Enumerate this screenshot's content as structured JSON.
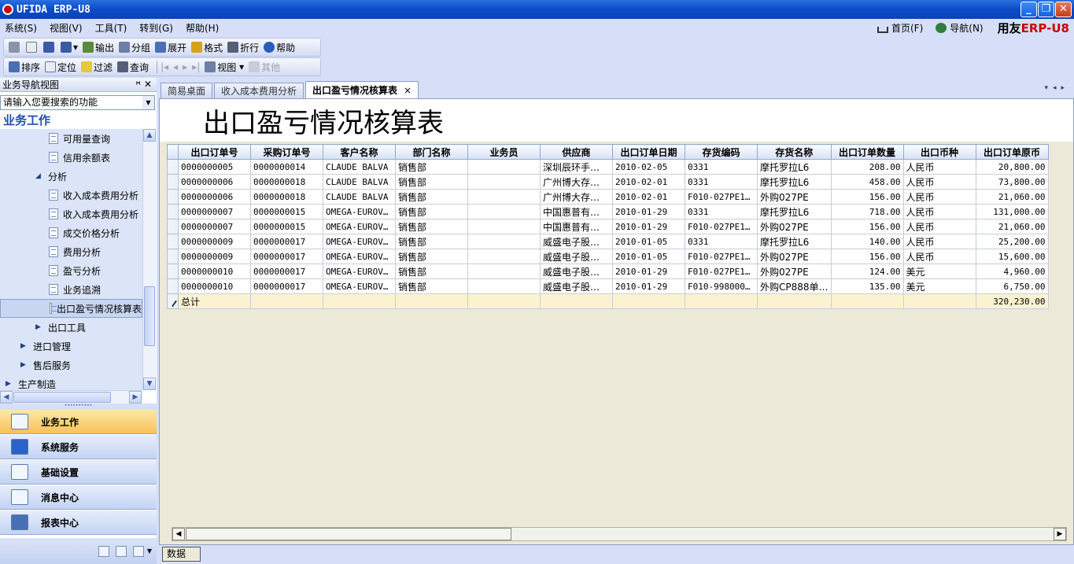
{
  "window": {
    "title": "UFIDA ERP-U8"
  },
  "menu": [
    "系统(S)",
    "视图(V)",
    "工具(T)",
    "转到(G)",
    "帮助(H)"
  ],
  "menu_right": {
    "home": "首页(F)",
    "nav": "导航(N)",
    "brand_a": "用友",
    "brand_b": "ERP-U8"
  },
  "toolbar1": [
    "输出",
    "分组",
    "展开",
    "格式",
    "折行",
    "帮助"
  ],
  "toolbar2": [
    "排序",
    "定位",
    "过滤",
    "查询",
    "视图",
    "其他"
  ],
  "left": {
    "header": "业务导航视图",
    "search_placeholder": "请输入您要搜索的功能",
    "section": "业务工作",
    "tree": [
      {
        "label": "可用量查询",
        "type": "doc",
        "indent": 3
      },
      {
        "label": "信用余额表",
        "type": "doc",
        "indent": 3
      },
      {
        "label": "分析",
        "type": "open",
        "indent": 2
      },
      {
        "label": "收入成本费用分析",
        "type": "doc",
        "indent": 3
      },
      {
        "label": "收入成本费用分析",
        "type": "doc",
        "indent": 3
      },
      {
        "label": "成交价格分析",
        "type": "doc",
        "indent": 3
      },
      {
        "label": "费用分析",
        "type": "doc",
        "indent": 3
      },
      {
        "label": "盈亏分析",
        "type": "doc",
        "indent": 3
      },
      {
        "label": "业务追溯",
        "type": "doc",
        "indent": 3
      },
      {
        "label": "出口盈亏情况核算表",
        "type": "doc",
        "indent": 3,
        "selected": true
      },
      {
        "label": "出口工具",
        "type": "closed",
        "indent": 2
      },
      {
        "label": "进口管理",
        "type": "closed",
        "indent": 1
      },
      {
        "label": "售后服务",
        "type": "closed",
        "indent": 1
      },
      {
        "label": "生产制造",
        "type": "closed",
        "indent": 0
      }
    ],
    "nav_buttons": [
      "业务工作",
      "系统服务",
      "基础设置",
      "消息中心",
      "报表中心"
    ]
  },
  "tabs": [
    {
      "label": "简易桌面"
    },
    {
      "label": "收入成本费用分析"
    },
    {
      "label": "出口盈亏情况核算表",
      "active": true,
      "close": "×"
    }
  ],
  "report": {
    "title": "出口盈亏情况核算表",
    "columns": [
      "出口订单号",
      "采购订单号",
      "客户名称",
      "部门名称",
      "业务员",
      "供应商",
      "出口订单日期",
      "存货编码",
      "存货名称",
      "出口订单数量",
      "出口币种",
      "出口订单原币"
    ],
    "rows": [
      [
        "0000000005",
        "0000000014",
        "CLAUDE BALVA",
        "销售部",
        "",
        "深圳辰环手…",
        "2010-02-05",
        "0331",
        "摩托罗拉L6",
        "208.00",
        "人民币",
        "20,800.00"
      ],
      [
        "0000000006",
        "0000000018",
        "CLAUDE BALVA",
        "销售部",
        "",
        "广州博大存…",
        "2010-02-01",
        "0331",
        "摩托罗拉L6",
        "458.00",
        "人民币",
        "73,800.00"
      ],
      [
        "0000000006",
        "0000000018",
        "CLAUDE BALVA",
        "销售部",
        "",
        "广州博大存…",
        "2010-02-01",
        "F010-027PE1…",
        "外购027PE",
        "156.00",
        "人民币",
        "21,060.00"
      ],
      [
        "0000000007",
        "0000000015",
        "OMEGA-EUROV…",
        "销售部",
        "",
        "中国惠普有…",
        "2010-01-29",
        "0331",
        "摩托罗拉L6",
        "718.00",
        "人民币",
        "131,000.00"
      ],
      [
        "0000000007",
        "0000000015",
        "OMEGA-EUROV…",
        "销售部",
        "",
        "中国惠普有…",
        "2010-01-29",
        "F010-027PE1…",
        "外购027PE",
        "156.00",
        "人民币",
        "21,060.00"
      ],
      [
        "0000000009",
        "0000000017",
        "OMEGA-EUROV…",
        "销售部",
        "",
        "威盛电子股…",
        "2010-01-05",
        "0331",
        "摩托罗拉L6",
        "140.00",
        "人民币",
        "25,200.00"
      ],
      [
        "0000000009",
        "0000000017",
        "OMEGA-EUROV…",
        "销售部",
        "",
        "威盛电子股…",
        "2010-01-05",
        "F010-027PE1…",
        "外购027PE",
        "156.00",
        "人民币",
        "15,600.00"
      ],
      [
        "0000000010",
        "0000000017",
        "OMEGA-EUROV…",
        "销售部",
        "",
        "威盛电子股…",
        "2010-01-29",
        "F010-027PE1…",
        "外购027PE",
        "124.00",
        "美元",
        "4,960.00"
      ],
      [
        "0000000010",
        "0000000017",
        "OMEGA-EUROV…",
        "销售部",
        "",
        "威盛电子股…",
        "2010-01-29",
        "F010-998000…",
        "外购CP888单…",
        "135.00",
        "美元",
        "6,750.00"
      ]
    ],
    "total_label": "总计",
    "total_value": "320,230.00"
  },
  "bottom_tab": "数据"
}
